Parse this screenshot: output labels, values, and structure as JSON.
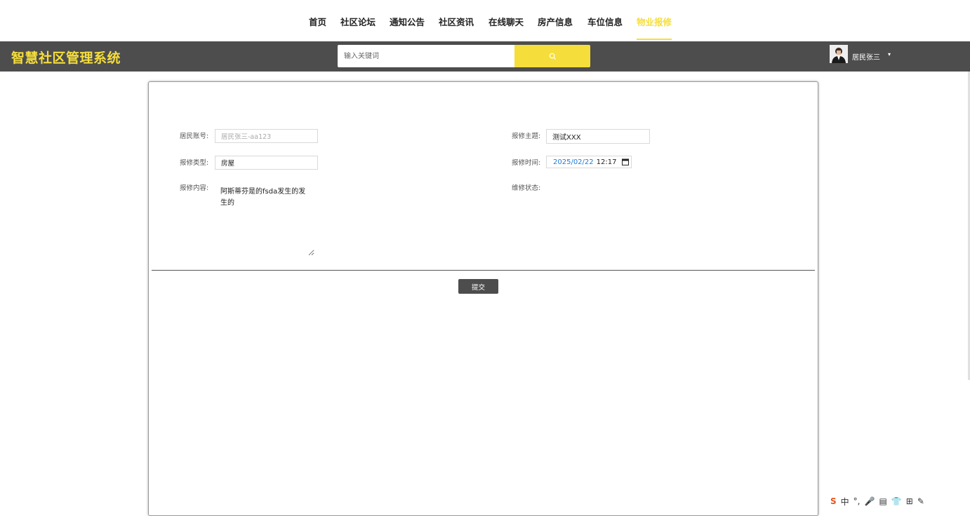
{
  "nav": {
    "items": [
      {
        "label": "首页"
      },
      {
        "label": "社区论坛"
      },
      {
        "label": "通知公告"
      },
      {
        "label": "社区资讯"
      },
      {
        "label": "在线聊天"
      },
      {
        "label": "房产信息"
      },
      {
        "label": "车位信息"
      },
      {
        "label": "物业报修",
        "active": true
      }
    ]
  },
  "header": {
    "logo": "智慧社区管理系统",
    "search_placeholder": "输入关键词",
    "user_name": "居民张三",
    "caret": "▾"
  },
  "form": {
    "account_label": "居民账号:",
    "account_value": "居民张三-aa123",
    "subject_label": "报修主题:",
    "subject_value": "测试XXX",
    "type_label": "报修类型:",
    "type_value": "房屋",
    "time_label": "报修时间:",
    "time_date": "2025/02/22",
    "time_clock": "12:17",
    "content_label": "报修内容:",
    "content_value": "阿斯蒂芬是的fsda发生的发生的",
    "status_label": "维修状态:",
    "submit_label": "提交"
  },
  "ime": {
    "items": [
      "S",
      "中",
      "°,",
      "🎤",
      "▤",
      "👕",
      "⊞",
      "✎"
    ]
  },
  "colors": {
    "accent": "#f5de3c",
    "header_bg": "#4d4d4d",
    "button_bg": "#4d4d4d"
  }
}
